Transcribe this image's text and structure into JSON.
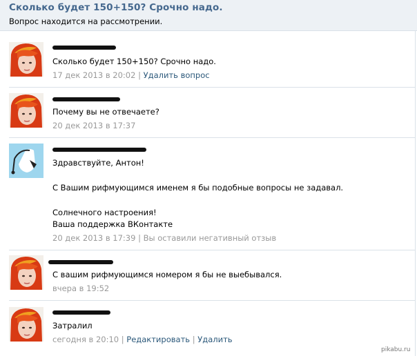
{
  "question": {
    "title": "Сколько будет 150+150? Срочно надо.",
    "status": "Вопрос находится на рассмотрении."
  },
  "messages": [
    {
      "text": "Сколько будет 150+150? Срочно надо.",
      "date": "17 дек 2013 в 20:02",
      "sep": "|",
      "action": "Удалить вопрос"
    },
    {
      "text": "Почему вы не отвечаете?",
      "date": "20 дек 2013 в 17:37"
    },
    {
      "line1": "Здравствуйте, Антон!",
      "line2": "С Вашим рифмующимся именем я бы подобные вопросы не задавал.",
      "line3": "Солнечного настроения!",
      "line4": "Ваша поддержка ВКонтакте",
      "date": "20 дек 2013 в 17:39",
      "sep": "|",
      "note": "Вы оставили негативный отзыв"
    },
    {
      "text": "С вашим рифмующимся номером я бы не выебывался.",
      "date": "вчера в 19:52"
    },
    {
      "text": "Затралил",
      "date": "сегодня в 20:10",
      "sep1": "|",
      "action1": "Редактировать",
      "sep2": "|",
      "action2": "Удалить"
    }
  ],
  "watermark": "pikabu.ru",
  "colors": {
    "header_bg": "#edf1f5",
    "title": "#45688e",
    "link": "#2b587a",
    "meta": "#999999",
    "separator": "#dae1e8"
  }
}
